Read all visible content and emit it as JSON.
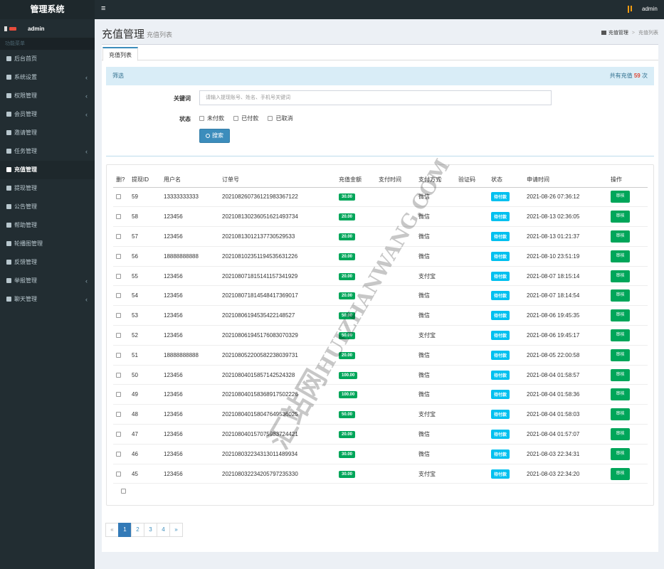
{
  "app": {
    "title": "管理系统",
    "user": "admin"
  },
  "sidebar": {
    "user_name": "admin",
    "header": "功能菜单",
    "items": [
      {
        "label": "后台首页",
        "has_arrow": false,
        "active": false
      },
      {
        "label": "系统设置",
        "has_arrow": true,
        "active": false
      },
      {
        "label": "权限管理",
        "has_arrow": true,
        "active": false
      },
      {
        "label": "会员管理",
        "has_arrow": true,
        "active": false
      },
      {
        "label": "邀请管理",
        "has_arrow": false,
        "active": false
      },
      {
        "label": "任务管理",
        "has_arrow": true,
        "active": false
      },
      {
        "label": "充值管理",
        "has_arrow": false,
        "active": true
      },
      {
        "label": "提现管理",
        "has_arrow": false,
        "active": false
      },
      {
        "label": "公告管理",
        "has_arrow": false,
        "active": false
      },
      {
        "label": "帮助管理",
        "has_arrow": false,
        "active": false
      },
      {
        "label": "轮播图管理",
        "has_arrow": false,
        "active": false
      },
      {
        "label": "反馈管理",
        "has_arrow": false,
        "active": false
      },
      {
        "label": "举报管理",
        "has_arrow": true,
        "active": false
      },
      {
        "label": "聊天管理",
        "has_arrow": true,
        "active": false
      }
    ]
  },
  "header": {
    "title": "充值管理",
    "subtitle": "充值列表",
    "breadcrumb": {
      "home": "充值管理",
      "current": "充值列表"
    }
  },
  "tabs": [
    "充值列表"
  ],
  "filter": {
    "title": "筛选",
    "count_prefix": "共有充值",
    "count": "59",
    "count_suffix": "次",
    "keyword_label": "关键词",
    "keyword_placeholder": "请输入提现账号、姓名、手机号关键词",
    "status_label": "状态",
    "status_options": [
      "未付款",
      "已付款",
      "已取消"
    ],
    "search_label": "搜索"
  },
  "table": {
    "columns": [
      "删?",
      "提现ID",
      "用户名",
      "订单号",
      "充值金额",
      "支付时间",
      "支付方式",
      "验证码",
      "状态",
      "申请时间",
      "操作"
    ],
    "action_label": "审核",
    "rows": [
      {
        "id": "59",
        "user": "13333333333",
        "order": "20210826073612198336712​2",
        "amount": "30.00",
        "pay_time": "",
        "method": "微信",
        "code": "",
        "status": "待付款",
        "apply_time": "2021-08-26 07:36:12"
      },
      {
        "id": "58",
        "user": "123456",
        "order": "2021081302360516214937​34",
        "amount": "20.00",
        "pay_time": "",
        "method": "微信",
        "code": "",
        "status": "待付款",
        "apply_time": "2021-08-13 02:36:05"
      },
      {
        "id": "57",
        "user": "123456",
        "order": "202108130121377305295​33",
        "amount": "20.00",
        "pay_time": "",
        "method": "微信",
        "code": "",
        "status": "待付款",
        "apply_time": "2021-08-13 01:21:37"
      },
      {
        "id": "56",
        "user": "18888888888",
        "order": "2021081023511945356312​26",
        "amount": "20.00",
        "pay_time": "",
        "method": "微信",
        "code": "",
        "status": "待付款",
        "apply_time": "2021-08-10 23:51:19"
      },
      {
        "id": "55",
        "user": "123456",
        "order": "202108071815141157341929",
        "amount": "20.00",
        "pay_time": "",
        "method": "支付宝",
        "code": "",
        "status": "待付款",
        "apply_time": "2021-08-07 18:15:14"
      },
      {
        "id": "54",
        "user": "123456",
        "order": "2021080718145484173​69017",
        "amount": "20.00",
        "pay_time": "",
        "method": "微信",
        "code": "",
        "status": "待付款",
        "apply_time": "2021-08-07 18:14:54"
      },
      {
        "id": "53",
        "user": "123456",
        "order": "2021080619453542214​8527",
        "amount": "50.00",
        "pay_time": "",
        "method": "微信",
        "code": "",
        "status": "待付款",
        "apply_time": "2021-08-06 19:45:35"
      },
      {
        "id": "52",
        "user": "123456",
        "order": "202108061945176083070329",
        "amount": "50.00",
        "pay_time": "",
        "method": "支付宝",
        "code": "",
        "status": "待付款",
        "apply_time": "2021-08-06 19:45:17"
      },
      {
        "id": "51",
        "user": "18888888888",
        "order": "202108052200582238039731",
        "amount": "20.00",
        "pay_time": "",
        "method": "微信",
        "code": "",
        "status": "待付款",
        "apply_time": "2021-08-05 22:00:58"
      },
      {
        "id": "50",
        "user": "123456",
        "order": "2021080401585714252​4328",
        "amount": "100.00",
        "pay_time": "",
        "method": "微信",
        "code": "",
        "status": "待付款",
        "apply_time": "2021-08-04 01:58:57"
      },
      {
        "id": "49",
        "user": "123456",
        "order": "202108040158368917502226",
        "amount": "100.00",
        "pay_time": "",
        "method": "微信",
        "code": "",
        "status": "待付款",
        "apply_time": "2021-08-04 01:58:36"
      },
      {
        "id": "48",
        "user": "123456",
        "order": "2021080401580476495​36025",
        "amount": "50.00",
        "pay_time": "",
        "method": "支付宝",
        "code": "",
        "status": "待付款",
        "apply_time": "2021-08-04 01:58:03"
      },
      {
        "id": "47",
        "user": "123456",
        "order": "202108040157075983724421",
        "amount": "20.00",
        "pay_time": "",
        "method": "微信",
        "code": "",
        "status": "待付款",
        "apply_time": "2021-08-04 01:57:07"
      },
      {
        "id": "46",
        "user": "123456",
        "order": "202108032234313011489934",
        "amount": "30.00",
        "pay_time": "",
        "method": "微信",
        "code": "",
        "status": "待付款",
        "apply_time": "2021-08-03 22:34:31"
      },
      {
        "id": "45",
        "user": "123456",
        "order": "202108032234205797235330",
        "amount": "30.00",
        "pay_time": "",
        "method": "支付宝",
        "code": "",
        "status": "待付款",
        "apply_time": "2021-08-03 22:34:20"
      }
    ]
  },
  "pagination": {
    "prev": "«",
    "pages": [
      "1",
      "2",
      "3",
      "4"
    ],
    "active": "1",
    "next": "»"
  },
  "watermark": {
    "line1": "汇站网",
    "line2": "HUIZHANWANG.COM"
  }
}
